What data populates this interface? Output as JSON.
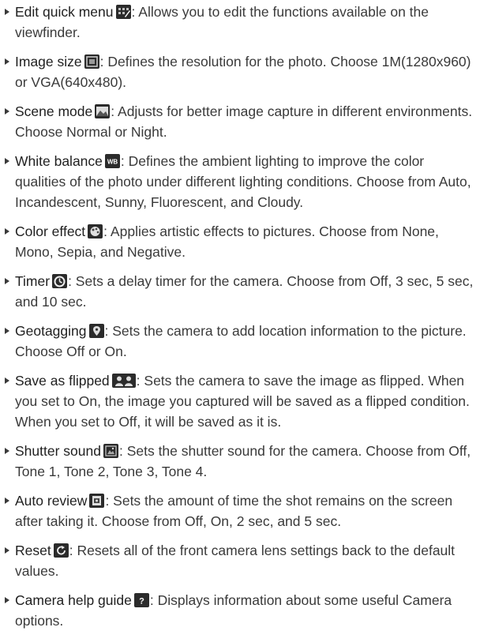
{
  "items": [
    {
      "name": "Edit quick menu",
      "icon": "edit-quick-menu-icon",
      "desc": ": Allows you to edit the functions available on the viewfinder."
    },
    {
      "name": "Image size",
      "icon": "image-size-icon",
      "desc": ": Defines the resolution for the photo. Choose 1M(1280x960) or VGA(640x480)."
    },
    {
      "name": "Scene mode",
      "icon": "scene-mode-icon",
      "desc": ": Adjusts for better image capture in different environments. Choose Normal or Night."
    },
    {
      "name": " White balance",
      "icon": "white-balance-icon",
      "icon_text": "WB",
      "desc": ": Defines the ambient lighting to improve the color qualities of the photo under different lighting conditions. Choose from Auto, Incandescent, Sunny, Fluorescent, and Cloudy."
    },
    {
      "name": "Color effect",
      "icon": "color-effect-icon",
      "desc": ": Applies artistic effects to pictures. Choose from None, Mono, Sepia, and Negative."
    },
    {
      "name": "Timer",
      "icon": "timer-icon",
      "desc": ": Sets a delay timer for the camera. Choose from Off, 3 sec, 5 sec, and 10 sec."
    },
    {
      "name": "Geotagging",
      "icon": "geotagging-icon",
      "desc": ": Sets the camera to add location information to the picture. Choose Off or On."
    },
    {
      "name": "Save as flipped",
      "icon": "save-as-flipped-icon",
      "desc": ": Sets the camera to save the image as flipped. When you set to On, the image you captured will be saved as a flipped condition. When you set to Off, it will be saved as it is."
    },
    {
      "name": "Shutter sound",
      "icon": "shutter-sound-icon",
      "desc": ": Sets the shutter sound for the camera. Choose from Off, Tone 1, Tone 2, Tone 3, Tone 4."
    },
    {
      "name": "Auto review",
      "icon": "auto-review-icon",
      "desc": ": Sets the amount of time the shot remains on the screen after taking it. Choose from Off, On, 2 sec, and 5 sec."
    },
    {
      "name": "Reset",
      "icon": "reset-icon",
      "desc": ": Resets all of the front camera lens settings back to the default values."
    },
    {
      "name": "Camera help guide",
      "icon": "camera-help-guide-icon",
      "icon_text": "?",
      "desc": ": Displays information about some useful Camera options."
    }
  ]
}
